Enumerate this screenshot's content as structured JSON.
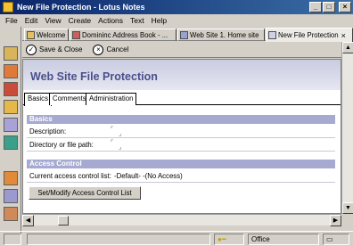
{
  "window": {
    "title": "New File Protection - Lotus Notes"
  },
  "menu": [
    "File",
    "Edit",
    "View",
    "Create",
    "Actions",
    "Text",
    "Help"
  ],
  "tabs": [
    {
      "label": "Welcome"
    },
    {
      "label": "Domininc Address Book - ..."
    },
    {
      "label": "Web Site 1. Home site"
    },
    {
      "label": "New File Protection",
      "active": true
    }
  ],
  "actions": {
    "save_close": "Save & Close",
    "cancel": "Cancel"
  },
  "document": {
    "title": "Web Site File Protection",
    "tabs": [
      "Basics",
      "Comments",
      "Administration"
    ],
    "sections": {
      "basics": "Basics",
      "access": "Access Control"
    },
    "fields": {
      "description_label": "Description:",
      "path_label": "Directory or file path:",
      "acl_label": "Current access control list:",
      "acl_value": "-Default- -(No Access)"
    },
    "acl_button": "Set/Modify Access Control List"
  },
  "status": {
    "location": "Office"
  },
  "colors": {
    "titlebar": "#0a246a",
    "header_text": "#4a4f8a",
    "section_bar": "#a7aad0"
  }
}
